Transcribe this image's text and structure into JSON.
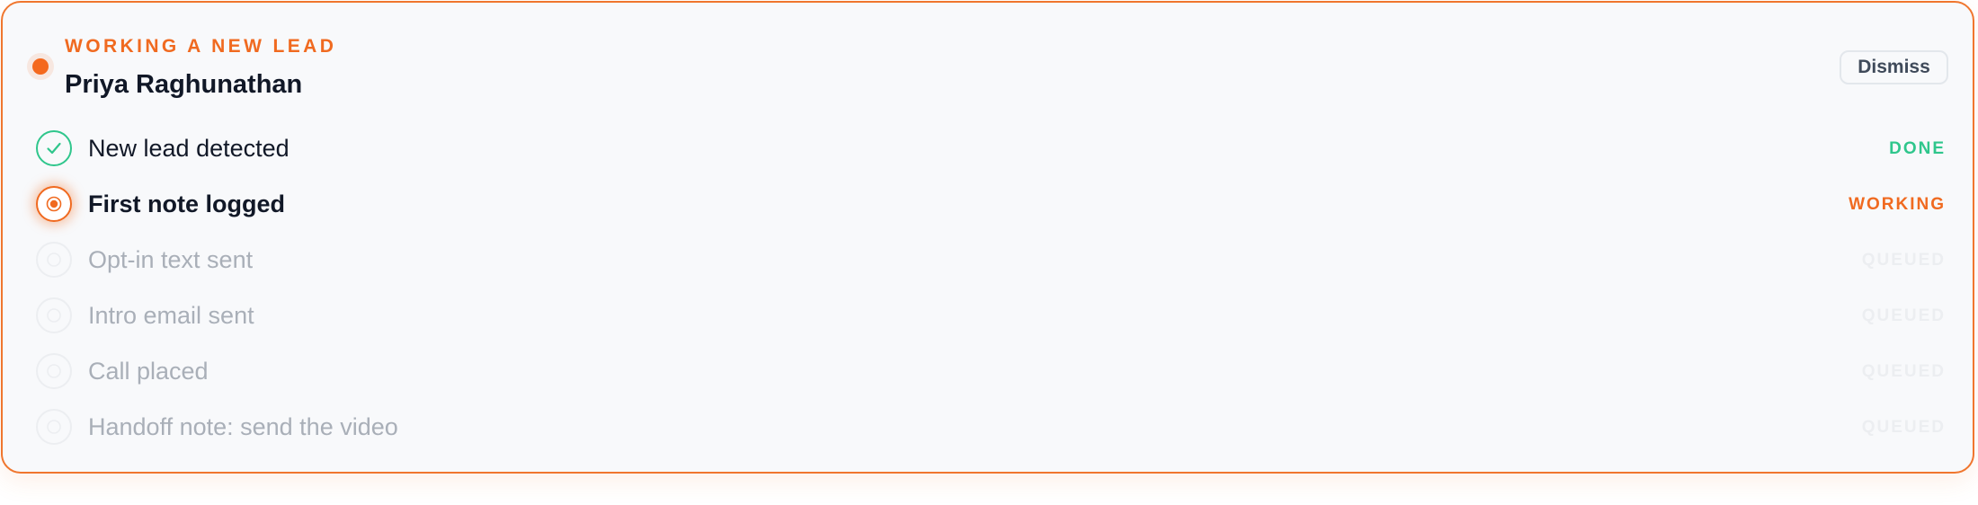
{
  "colors": {
    "accent": "#f06a20",
    "done": "#2fc68c",
    "queued": "#eceef1",
    "text_primary": "#111827",
    "text_muted": "#a9afb8",
    "card_bg": "#f8f9fb"
  },
  "header": {
    "eyebrow": "WORKING A NEW LEAD",
    "lead_name": "Priya Raghunathan",
    "status_dot_icon": "status-dot-icon"
  },
  "actions": {
    "dismiss_label": "Dismiss"
  },
  "steps": [
    {
      "label": "New lead detected",
      "status": "DONE",
      "state": "done",
      "icon": "check-circle-icon"
    },
    {
      "label": "First note logged",
      "status": "WORKING",
      "state": "working",
      "icon": "radio-active-icon"
    },
    {
      "label": "Opt-in text sent",
      "status": "QUEUED",
      "state": "queued",
      "icon": "pending-circle-icon"
    },
    {
      "label": "Intro email sent",
      "status": "QUEUED",
      "state": "queued",
      "icon": "pending-circle-icon"
    },
    {
      "label": "Call placed",
      "status": "QUEUED",
      "state": "queued",
      "icon": "pending-circle-icon"
    },
    {
      "label": "Handoff note: send the video",
      "status": "QUEUED",
      "state": "queued",
      "icon": "pending-circle-icon"
    }
  ]
}
